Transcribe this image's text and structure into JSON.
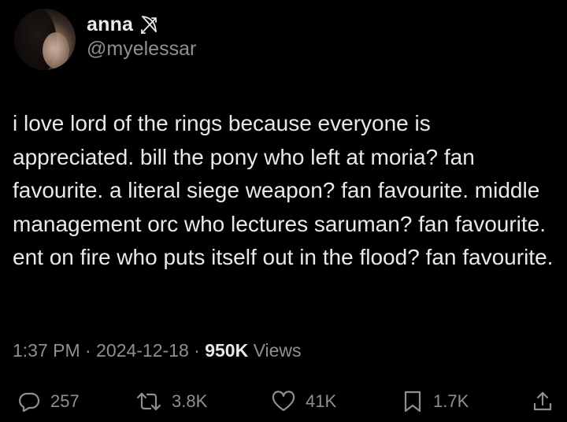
{
  "author": {
    "display_name": "anna",
    "handle": "@myelessar",
    "name_emoji_icon": "bow-and-arrow-icon"
  },
  "tweet": {
    "text": "i love lord of the rings because everyone is appreciated. bill the pony who left at moria? fan favourite. a literal siege weapon? fan favourite. middle management orc who lectures saruman? fan favourite. ent on fire who puts itself out in the flood? fan favourite."
  },
  "meta": {
    "time": "1:37 PM",
    "separator": "·",
    "date": "2024-12-18",
    "views_count": "950K",
    "views_label": "Views"
  },
  "actions": {
    "replies": "257",
    "reposts": "3.8K",
    "likes": "41K",
    "bookmarks": "1.7K"
  },
  "colors": {
    "background": "#000000",
    "primary_text": "#e7e9ea",
    "secondary_text": "#8b9097"
  }
}
